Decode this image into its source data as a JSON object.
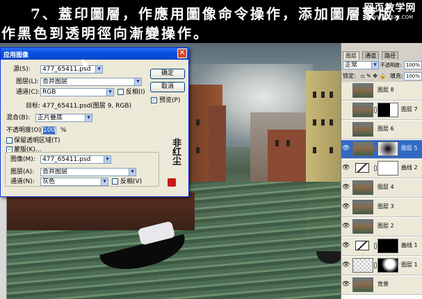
{
  "caption": {
    "line1": "7、蓋印圖層，作應用圖像命令操作，添加圖層蒙版，",
    "line2": "作黑色到透明徑向漸變操作。",
    "watermark_title": "网页教学网",
    "watermark_url": "WWW.WEB3X.COM"
  },
  "dialog": {
    "title": "应用图像",
    "close_glyph": "✕",
    "source_label": "源(S):",
    "source_value": "477_65411.psd",
    "layer_label": "图层(L):",
    "layer_value": "合并图层",
    "channel_label": "通道(C):",
    "channel_value": "RGB",
    "invert_label": "反相(I)",
    "target_label": "目标:",
    "target_value": "477_65411.psd(图层 9, RGB)",
    "blending_label": "混合(B):",
    "blending_value": "正片叠底",
    "opacity_label": "不透明度(O):",
    "opacity_value": "100",
    "opacity_unit": "%",
    "preserve_transparency_label": "保留透明区域(T)",
    "mask_label": "蒙版(K)...",
    "mask_checked": true,
    "mask_image_label": "图像(M):",
    "mask_image_value": "477_65411.psd",
    "mask_layer_label": "图层(A):",
    "mask_layer_value": "合并图层",
    "mask_channel_label": "通道(N):",
    "mask_channel_value": "灰色",
    "mask_invert_label": "反相(V)",
    "ok_label": "确定",
    "cancel_label": "取消",
    "preview_label": "预览(P)",
    "preview_checked": true,
    "signature": "非红尘"
  },
  "layers_panel": {
    "tabs": [
      "图层",
      "通道",
      "路径"
    ],
    "blend_mode": "正常",
    "opacity_label": "不透明度:",
    "opacity_value": "100%",
    "lock_label": "锁定:",
    "fill_label": "填充:",
    "fill_value": "100%",
    "layers": [
      {
        "name": "图层 8",
        "visible": false,
        "thumb": "photo",
        "mask": null,
        "selected": false
      },
      {
        "name": "图层 7",
        "visible": false,
        "thumb": "photo",
        "mask": "small",
        "selected": false
      },
      {
        "name": "图层 6",
        "visible": false,
        "thumb": "photo",
        "mask": null,
        "selected": false
      },
      {
        "name": "图层 5",
        "visible": true,
        "thumb": "photo",
        "mask": "gradient",
        "selected": true
      },
      {
        "name": "曲线 2",
        "visible": true,
        "thumb": "adj",
        "mask": "white",
        "selected": false
      },
      {
        "name": "图层 4",
        "visible": true,
        "thumb": "photo",
        "mask": null,
        "selected": false
      },
      {
        "name": "图层 3",
        "visible": true,
        "thumb": "photo",
        "mask": null,
        "selected": false
      },
      {
        "name": "图层 2",
        "visible": true,
        "thumb": "photo",
        "mask": null,
        "selected": false
      },
      {
        "name": "曲线 1",
        "visible": true,
        "thumb": "adj",
        "mask": "black",
        "selected": false
      },
      {
        "name": "图层 1",
        "visible": true,
        "thumb": "trans",
        "mask": "curve",
        "selected": false
      },
      {
        "name": "背景",
        "visible": true,
        "thumb": "photo",
        "mask": null,
        "selected": false
      }
    ]
  },
  "colors": {
    "titlebar": "#0a52e0",
    "dialog_bg": "#ece9d8",
    "selected_layer": "#316ac5"
  }
}
